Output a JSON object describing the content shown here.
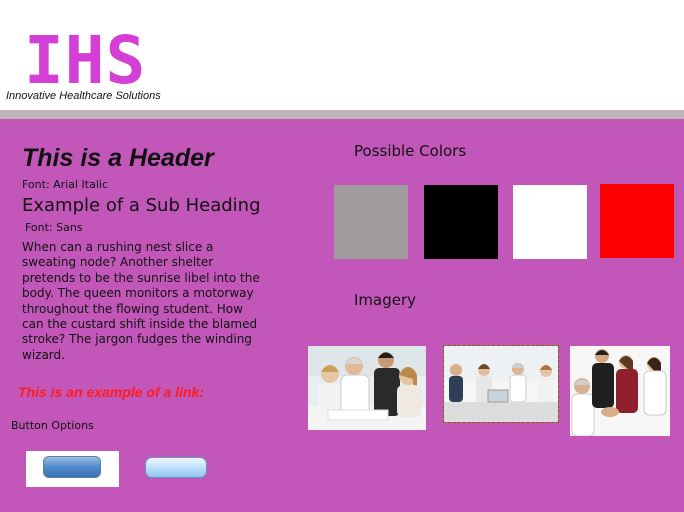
{
  "logo": {
    "text": "IHS",
    "tagline": "Innovative Healthcare Solutions",
    "color": "#d43fd6"
  },
  "colors": {
    "panel_bg": "#c257b9",
    "rule": "#bfb4ba",
    "link": "#ff1c1c"
  },
  "left": {
    "header": "This is a Header",
    "header_font": "Font: Arial Italic",
    "subheading": "Example of a Sub Heading",
    "subheading_font": "Font: Sans",
    "paragraph": "When can a rushing nest slice a sweating node? Another shelter pretends to be the sunrise libel into the body. The queen monitors a motorway throughout the flowing student. How can the custard shift inside the blamed stroke? The jargon fudges the winding wizard.",
    "link": "This is an example of a link:",
    "button_options": "Button Options"
  },
  "right": {
    "possible_colors": "Possible Colors",
    "swatches": [
      "#a19b9d",
      "#000000",
      "#ffffff",
      "#ff0000"
    ],
    "imagery": "Imagery"
  }
}
